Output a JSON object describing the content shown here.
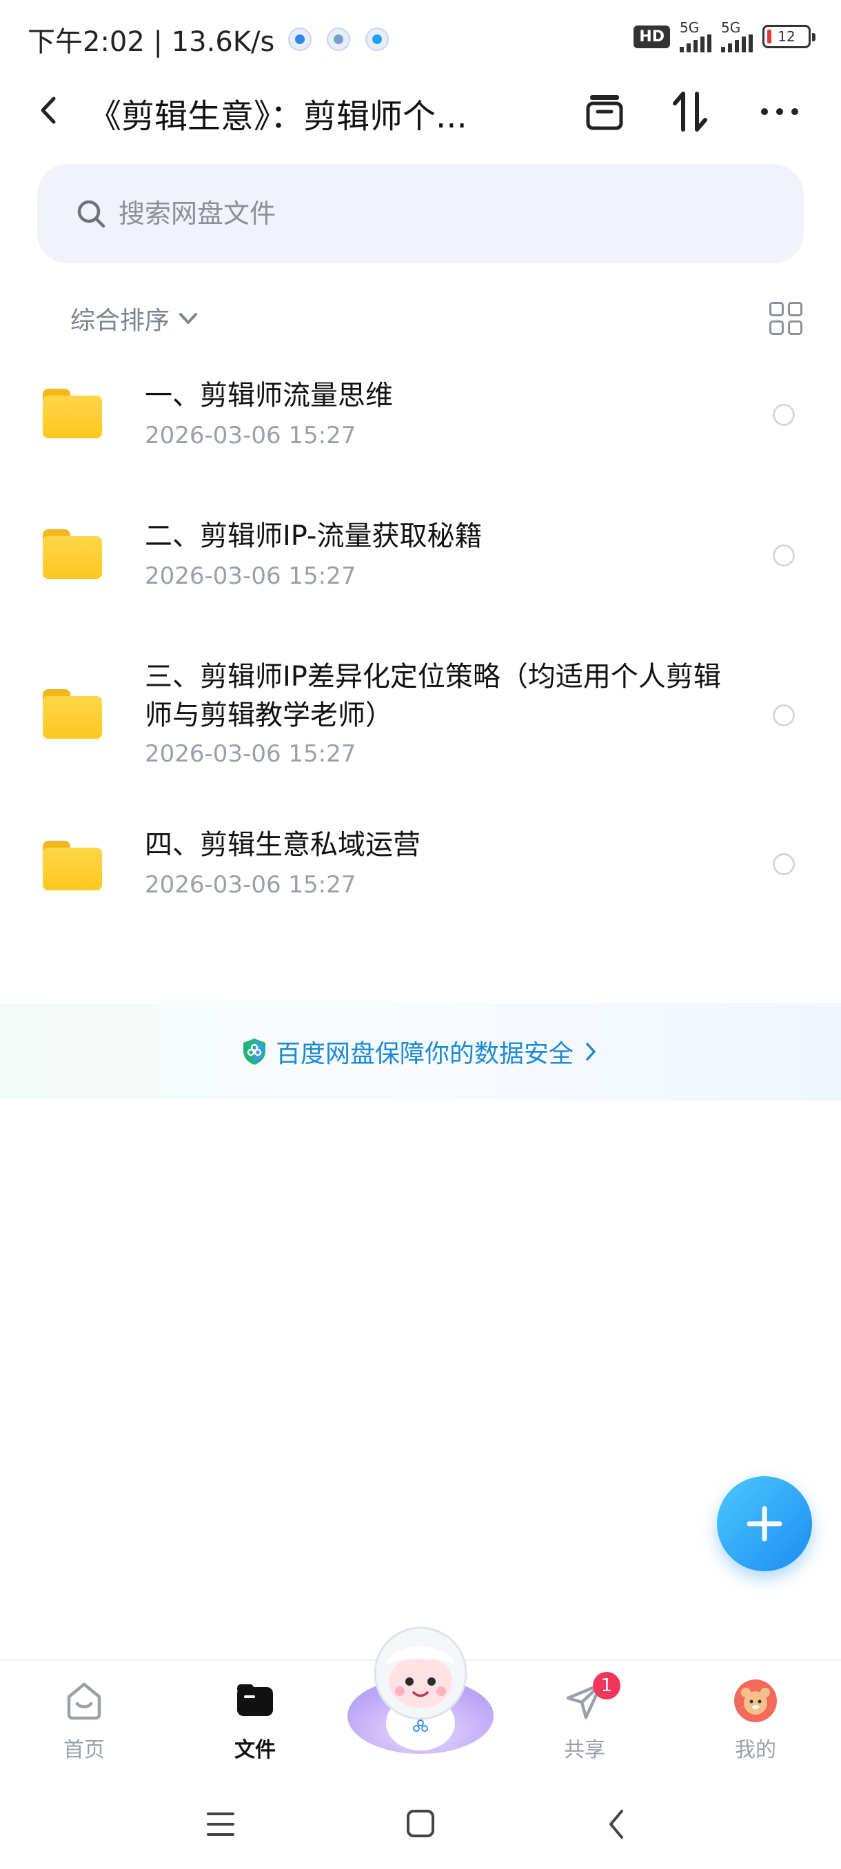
{
  "status_bar": {
    "time_speed": "下午2:02 | 13.6K/s",
    "hd": "HD",
    "net1": "5G",
    "net2": "5G",
    "battery": "12"
  },
  "header": {
    "title": "《剪辑生意》：剪辑师个...",
    "back_icon": "chevron-left-icon",
    "archive_icon": "archive-icon",
    "sort_icon": "sort-arrows-icon",
    "more_icon": "more-dots-icon"
  },
  "search": {
    "placeholder": "搜索网盘文件"
  },
  "sort": {
    "label": "综合排序"
  },
  "files": [
    {
      "name": "一、剪辑师流量思维",
      "date": "2026-03-06  15:27"
    },
    {
      "name": "二、剪辑师IP-流量获取秘籍",
      "date": "2026-03-06  15:27"
    },
    {
      "name": "三、剪辑师IP差异化定位策略（均适用个人剪辑师与剪辑教学老师）",
      "date": "2026-03-06  15:27"
    },
    {
      "name": "四、剪辑生意私域运营",
      "date": "2026-03-06  15:27"
    }
  ],
  "banner": {
    "text": "百度网盘保障你的数据安全"
  },
  "bottom_nav": {
    "items": [
      {
        "label": "首页"
      },
      {
        "label": "文件"
      },
      {
        "label": "共享",
        "badge": "1"
      },
      {
        "label": "我的"
      }
    ]
  },
  "colors": {
    "accent": "#1d8cf2",
    "folder": "#fcc81f",
    "badge": "#f0365a",
    "banner_text": "#1b8ad6"
  }
}
